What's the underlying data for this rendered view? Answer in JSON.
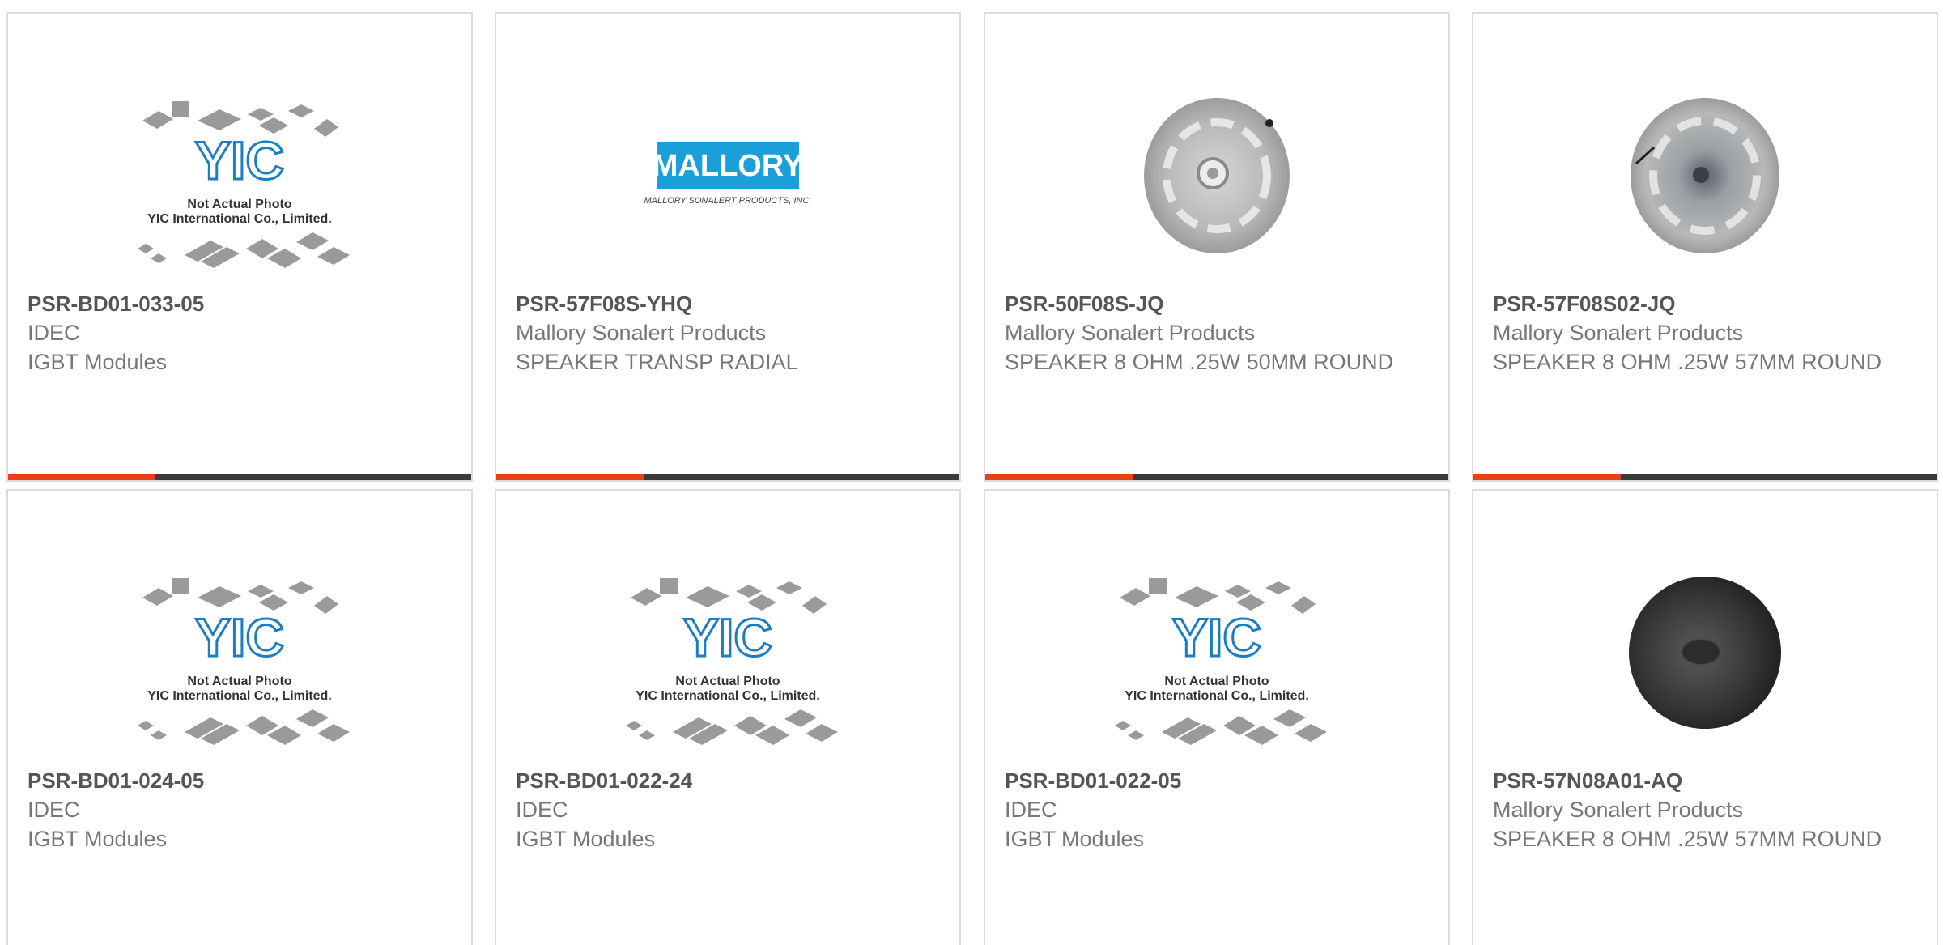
{
  "colors": {
    "accent": "#e8401a",
    "bar": "#3a3a3a",
    "yic_blue": "#1b7ec2",
    "mallory_blue": "#1a9fd8"
  },
  "products": [
    {
      "part_number": "PSR-BD01-033-05",
      "manufacturer": "IDEC",
      "description": "IGBT Modules",
      "image": "yic-placeholder-image",
      "image_text": {
        "logo": "YIC",
        "line1": "Not Actual Photo",
        "line2": "YIC International Co., Limited."
      }
    },
    {
      "part_number": "PSR-57F08S-YHQ",
      "manufacturer": "Mallory Sonalert Products",
      "description": "SPEAKER TRANSP RADIAL",
      "image": "mallory-logo-image",
      "image_text": {
        "logo": "MALLORY",
        "sub": "MALLORY SONALERT PRODUCTS, INC."
      }
    },
    {
      "part_number": "PSR-50F08S-JQ",
      "manufacturer": "Mallory Sonalert Products",
      "description": "SPEAKER 8 OHM .25W 50MM ROUND",
      "image": "transparent-speaker-image"
    },
    {
      "part_number": "PSR-57F08S02-JQ",
      "manufacturer": "Mallory Sonalert Products",
      "description": "SPEAKER 8 OHM .25W 57MM ROUND",
      "image": "transparent-speaker-image"
    },
    {
      "part_number": "PSR-BD01-024-05",
      "manufacturer": "IDEC",
      "description": "IGBT Modules",
      "image": "yic-placeholder-image",
      "image_text": {
        "logo": "YIC",
        "line1": "Not Actual Photo",
        "line2": "YIC International Co., Limited."
      }
    },
    {
      "part_number": "PSR-BD01-022-24",
      "manufacturer": "IDEC",
      "description": "IGBT Modules",
      "image": "yic-placeholder-image",
      "image_text": {
        "logo": "YIC",
        "line1": "Not Actual Photo",
        "line2": "YIC International Co., Limited."
      }
    },
    {
      "part_number": "PSR-BD01-022-05",
      "manufacturer": "IDEC",
      "description": "IGBT Modules",
      "image": "yic-placeholder-image",
      "image_text": {
        "logo": "YIC",
        "line1": "Not Actual Photo",
        "line2": "YIC International Co., Limited."
      }
    },
    {
      "part_number": "PSR-57N08A01-AQ",
      "manufacturer": "Mallory Sonalert Products",
      "description": "SPEAKER 8 OHM .25W 57MM ROUND",
      "image": "black-speaker-image"
    }
  ]
}
